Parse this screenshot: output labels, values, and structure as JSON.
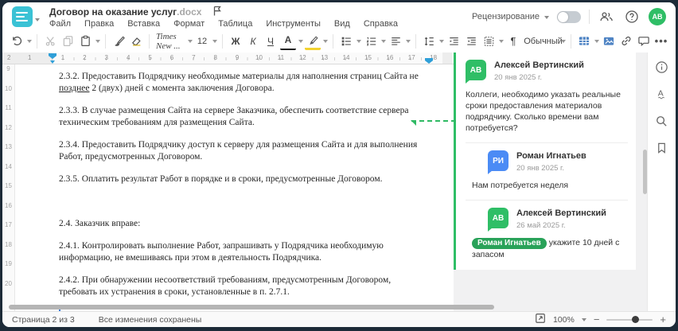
{
  "window": {
    "title": "Договор на оказание услуг",
    "title_ext": ".docx"
  },
  "menu": {
    "items": [
      "Файл",
      "Правка",
      "Вставка",
      "Формат",
      "Таблица",
      "Инструменты",
      "Вид",
      "Справка"
    ]
  },
  "header": {
    "review_label": "Рецензирование",
    "avatar_initials": "АВ"
  },
  "toolbar": {
    "font_name": "Times New ...",
    "font_size": "12",
    "bold_letter": "Ж",
    "italic_letter": "К",
    "underline_letter": "Ч",
    "font_color_letter": "А",
    "paragraph_mark": "¶",
    "style_name": "Обычный",
    "more_label": "•••"
  },
  "ruler": {
    "margin_numbers": [
      "2",
      "1"
    ],
    "numbers": [
      "1",
      "2",
      "3",
      "4",
      "5",
      "6",
      "7",
      "8",
      "9",
      "10",
      "11",
      "12",
      "13",
      "14",
      "15",
      "16",
      "17",
      "18"
    ],
    "v_numbers": [
      "9",
      "10",
      "11",
      "12",
      "13",
      "14",
      "15",
      "16",
      "17",
      "18",
      "19",
      "20"
    ]
  },
  "doc": {
    "p1": {
      "before": "2.3.2. Предоставить Подрядчику необходимые материалы для наполнения страниц Сайта не ",
      "underlined": "позднее",
      "after": " 2 (двух) дней с момента заключения Договора."
    },
    "paragraphs": [
      "2.3.3. В случае размещения Сайта на сервере Заказчика, обеспечить соответствие сервера техническим требованиям для размещения Сайта.",
      "2.3.4. Предоставить Подрядчику доступ к серверу для размещения Сайта и для выполнения Работ, предусмотренных Договором.",
      "2.3.5. Оплатить результат Работ в порядке и в сроки, предусмотренные Договором.",
      "",
      "2.4. Заказчик вправе:",
      "2.4.1. Контролировать выполнение Работ, запрашивать у Подрядчика необходимую информацию, не вмешиваясь при этом в деятельность Подрядчика.",
      "2.4.2. При обнаружении несоответствий требованиям, предусмотренным Договором, требовать их устранения в сроки, установленные в п. 2.7.1."
    ]
  },
  "comments": {
    "c1": {
      "initials": "АВ",
      "name": "Алексей Вертинский",
      "date": "20 янв 2025 г.",
      "text": "Коллеги, необходимо указать реальные сроки предоставления материалов подрядчику. Сколько времени вам потребуется?"
    },
    "c2": {
      "initials": "РИ",
      "name": "Роман Игнатьев",
      "date": "20 янв 2025 г.",
      "text": "Нам потребуется неделя"
    },
    "c3": {
      "initials": "АВ",
      "name": "Алексей Вертинский",
      "date": "26 май 2025 г.",
      "mention": "Роман Игнатьев",
      "text": "укажите 10 дней с запасом"
    }
  },
  "statusbar": {
    "page_info": "Страница 2 из 3",
    "save_status": "Все изменения сохранены",
    "zoom_value": "100%",
    "zoom_out": "−",
    "zoom_in": "+"
  },
  "colors": {
    "brand_teal": "#3ac2d5",
    "comment_green": "#2fbe66",
    "reply_blue": "#4b8bf5",
    "mention_green": "#29a259",
    "toolbar_blue": "#4f84c4",
    "ruler_marker_blue": "#2f9fd8",
    "cursor_blue": "#3a7bd5"
  }
}
